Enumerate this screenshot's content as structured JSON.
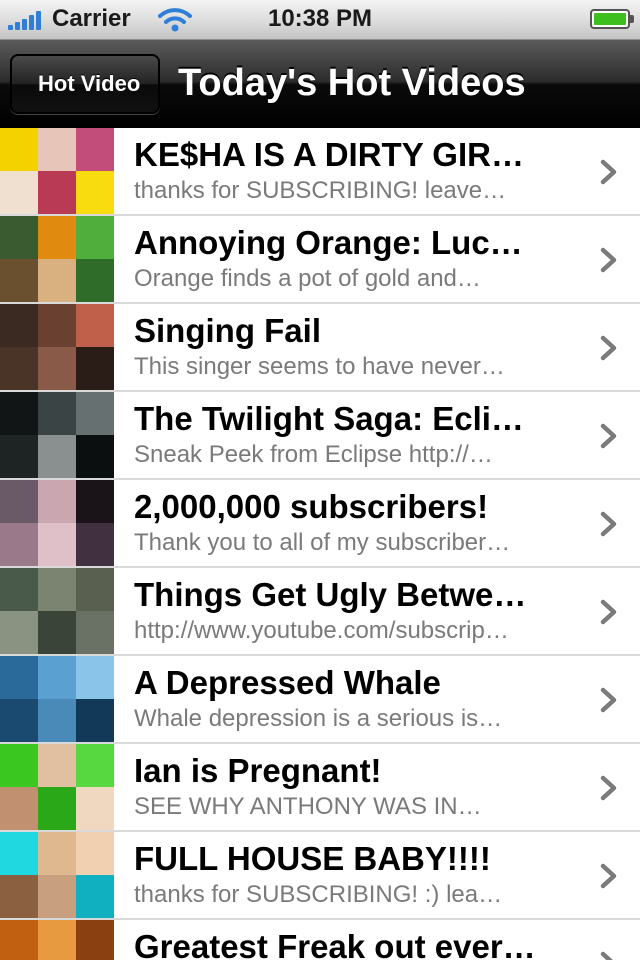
{
  "status_bar": {
    "carrier": "Carrier",
    "time": "10:38 PM",
    "battery_level": 1.0,
    "battery_color": "#3fbf1f",
    "signal_icon": "signal-bars-icon",
    "wifi_icon": "wifi-icon"
  },
  "nav_bar": {
    "back_label": "Hot Video",
    "title": "Today's Hot Videos"
  },
  "videos": [
    {
      "title": "KE$HA IS A DIRTY GIR…",
      "subtitle": "thanks for SUBSCRIBING! leave…",
      "thumb_colors": [
        "#f4d200",
        "#e7c5b8",
        "#c24c7a",
        "#f0e0d0",
        "#b83a55",
        "#f8dc10"
      ]
    },
    {
      "title": "Annoying Orange: Luc…",
      "subtitle": "Orange finds a pot of gold and…",
      "thumb_colors": [
        "#3a5a30",
        "#e08a10",
        "#4fae3c",
        "#6b5030",
        "#d9b080",
        "#2f6c2a"
      ]
    },
    {
      "title": "Singing Fail",
      "subtitle": "This singer seems to have never…",
      "thumb_colors": [
        "#3a2a22",
        "#6a4030",
        "#c0604a",
        "#4a3428",
        "#8a5a48",
        "#2a1c16"
      ]
    },
    {
      "title": "The Twilight Saga: Ecli…",
      "subtitle": "Sneak Peek from Eclipse  http://…",
      "thumb_colors": [
        "#111515",
        "#3a4444",
        "#667070",
        "#1e2424",
        "#8a9090",
        "#0c0f10"
      ]
    },
    {
      "title": "2,000,000 subscribers!",
      "subtitle": "Thank you to all of my subscriber…",
      "thumb_colors": [
        "#6a5a68",
        "#caa6b0",
        "#1a1418",
        "#9a7a8a",
        "#e0c0c8",
        "#403040"
      ]
    },
    {
      "title": "Things Get Ugly Betwe…",
      "subtitle": "http://www.youtube.com/subscrip…",
      "thumb_colors": [
        "#4a5a4a",
        "#7a8470",
        "#5a6050",
        "#8a9282",
        "#3a4438",
        "#6a7266"
      ]
    },
    {
      "title": "A Depressed Whale",
      "subtitle": "Whale depression is a serious is…",
      "thumb_colors": [
        "#2a6a9a",
        "#5aa0d0",
        "#8ac4e8",
        "#1a4a70",
        "#4a8ab8",
        "#123a58"
      ]
    },
    {
      "title": "Ian is Pregnant!",
      "subtitle": "SEE WHY ANTHONY WAS IN…",
      "thumb_colors": [
        "#3ac820",
        "#e0c0a0",
        "#58d840",
        "#c09070",
        "#2aa818",
        "#f0d8c0"
      ]
    },
    {
      "title": "FULL HOUSE BABY!!!!",
      "subtitle": "thanks for SUBSCRIBING! :) lea…",
      "thumb_colors": [
        "#20d8e0",
        "#e0b890",
        "#f0d0b0",
        "#8a6040",
        "#c8a080",
        "#10b0c0"
      ]
    },
    {
      "title": "Greatest Freak out ever…",
      "subtitle": "",
      "thumb_colors": [
        "#c06010",
        "#e89a40",
        "#8a4010",
        "#f0b060",
        "#a05020",
        "#d88030"
      ]
    }
  ]
}
